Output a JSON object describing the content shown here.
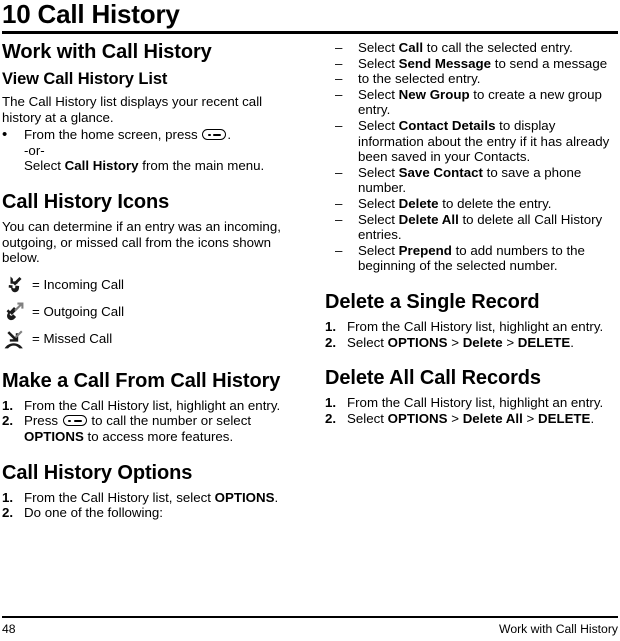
{
  "header": {
    "chapter_number": "10",
    "chapter_title": "10 Call History"
  },
  "left_column": {
    "section_title": "Work with Call History",
    "view_list": {
      "heading": "View Call History List",
      "intro": "The Call History list displays your recent call history at a glance.",
      "bullet_marker": "•",
      "bullet_text_part1": "From the home screen, press",
      "bullet_text_part2": ".",
      "or_text": "-or-",
      "bullet_text_part3": "Select",
      "bullet_bold": "Call History",
      "bullet_text_part4": "from the main menu."
    },
    "icons_section": {
      "heading": "Call History Icons",
      "intro": "You can determine if an entry was an incoming, outgoing, or missed call from the icons shown below.",
      "legend": [
        {
          "icon": "incoming-call-icon",
          "label": "= Incoming Call"
        },
        {
          "icon": "outgoing-call-icon",
          "label": "= Outgoing Call"
        },
        {
          "icon": "missed-call-icon",
          "label": "= Missed Call"
        }
      ]
    },
    "make_call": {
      "heading": "Make a Call From Call History",
      "step1_num": "1.",
      "step1_text": "From the Call History list, highlight an entry.",
      "step2_num": "2.",
      "step2_pre": "Press",
      "step2_mid": "to call the number or select",
      "step2_bold": "OPTIONS",
      "step2_post": "to access more features."
    },
    "options": {
      "heading": "Call History Options",
      "step1_num": "1.",
      "step1_pre": "From the Call History list, select",
      "step1_bold": "OPTIONS",
      "step1_post": ".",
      "step2_num": "2.",
      "step2_text": "Do one of the following:"
    }
  },
  "right_column": {
    "dash_marker": "–",
    "option_items": [
      {
        "pre": "Select",
        "bold": "Call",
        "post": "to call the selected entry."
      },
      {
        "pre": "Select",
        "bold": "Send Message",
        "post": "to send a message"
      },
      {
        "pre": "",
        "bold": "",
        "post": "to the selected entry."
      },
      {
        "pre": "Select",
        "bold": "New Group",
        "post": "to create a new group entry."
      },
      {
        "pre": "Select",
        "bold": "Contact Details",
        "post": "to display information about the entry if it has already been saved in your Contacts."
      },
      {
        "pre": "Select",
        "bold": "Save Contact",
        "post": "to save a phone number."
      },
      {
        "pre": "Select",
        "bold": "Delete",
        "post": "to delete the entry."
      },
      {
        "pre": "Select",
        "bold": "Delete All",
        "post": "to delete all Call History entries."
      },
      {
        "pre": "Select",
        "bold": "Prepend",
        "post": "to add numbers to the beginning of the selected number."
      }
    ],
    "delete_single": {
      "heading": "Delete a Single Record",
      "step1_num": "1.",
      "step1_text": "From the Call History list, highlight an entry.",
      "step2_num": "2.",
      "step2_pre": "Select",
      "step2_bold1": "OPTIONS",
      "step2_sep1": ">",
      "step2_bold2": "Delete",
      "step2_sep2": ">",
      "step2_bold3": "DELETE",
      "step2_post": "."
    },
    "delete_all": {
      "heading": "Delete All Call Records",
      "step1_num": "1.",
      "step1_text": "From the Call History list, highlight an entry.",
      "step2_num": "2.",
      "step2_pre": "Select",
      "step2_bold1": "OPTIONS",
      "step2_sep1": ">",
      "step2_bold2": "Delete All",
      "step2_sep2": ">",
      "step2_bold3": "DELETE",
      "step2_post": "."
    }
  },
  "footer": {
    "page_number": "48",
    "running_title": "Work with Call History"
  },
  "colors": {
    "text": "#000000",
    "background": "#ffffff",
    "icon_dark": "#1a1a1a",
    "icon_gray": "#808080"
  }
}
